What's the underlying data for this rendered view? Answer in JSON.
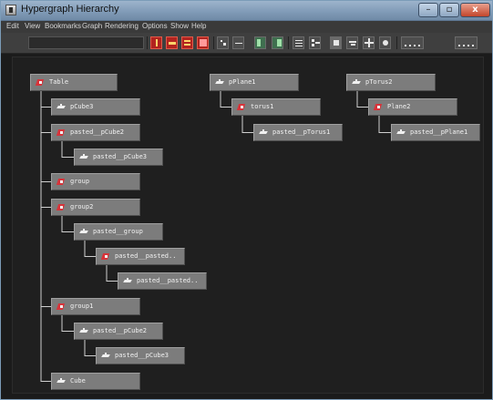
{
  "window": {
    "title": "Hypergraph Hierarchy",
    "buttons": {
      "minimize": "–",
      "maximize": "▫",
      "close": "x"
    }
  },
  "menu": [
    "Edit",
    "View",
    "Bookmarks",
    "Graph",
    "Rendering",
    "Options",
    "Show",
    "Help"
  ],
  "toolbar": {
    "name_field_value": "",
    "icons": [
      "filter-red-icon",
      "key-red-icon",
      "layers-red-icon",
      "expand-red-icon",
      "zoom-in-icon",
      "zoom-out-icon",
      "frame-all-icon",
      "frame-selected-icon",
      "align-icon",
      "hierarchy-icon",
      "render-icon",
      "toggle-icon",
      "layout-icon",
      "options-icon",
      "grid-icon",
      "dots-icon"
    ]
  },
  "graph": {
    "nodes": [
      {
        "name": "table",
        "label": "Table",
        "icon": "transform"
      },
      {
        "name": "pcube3",
        "label": "pCube3",
        "icon": "mesh"
      },
      {
        "name": "pasted-pcube2",
        "label": "pasted__pCube2",
        "icon": "transform"
      },
      {
        "name": "pasted-pcube3",
        "label": "pasted__pCube3",
        "icon": "mesh"
      },
      {
        "name": "group",
        "label": "group",
        "icon": "transform"
      },
      {
        "name": "group2",
        "label": "group2",
        "icon": "transform"
      },
      {
        "name": "pasted-group",
        "label": "pasted__group",
        "icon": "mesh"
      },
      {
        "name": "pasted-pasted-1",
        "label": "pasted__pasted..",
        "icon": "transform"
      },
      {
        "name": "pasted-pasted-2",
        "label": "pasted__pasted..",
        "icon": "mesh"
      },
      {
        "name": "group1",
        "label": "group1",
        "icon": "transform"
      },
      {
        "name": "pasted-pcube2-b",
        "label": "pasted__pCube2",
        "icon": "mesh"
      },
      {
        "name": "pasted-pcube3-b",
        "label": "pasted__pCube3",
        "icon": "mesh"
      },
      {
        "name": "cube",
        "label": "Cube",
        "icon": "mesh"
      },
      {
        "name": "pplane1",
        "label": "pPlane1",
        "icon": "mesh"
      },
      {
        "name": "torus1",
        "label": "torus1",
        "icon": "transform"
      },
      {
        "name": "pasted-ptorus1",
        "label": "pasted__pTorus1",
        "icon": "mesh"
      },
      {
        "name": "ptorus2",
        "label": "pTorus2",
        "icon": "mesh"
      },
      {
        "name": "plane2",
        "label": "Plane2",
        "icon": "transform"
      },
      {
        "name": "pasted-pplane1",
        "label": "pasted__pPlane1",
        "icon": "mesh"
      }
    ],
    "edges": [
      [
        "table",
        "pcube3"
      ],
      [
        "table",
        "pasted-pcube2"
      ],
      [
        "pasted-pcube2",
        "pasted-pcube3"
      ],
      [
        "table",
        "group"
      ],
      [
        "table",
        "group2"
      ],
      [
        "group2",
        "pasted-group"
      ],
      [
        "pasted-group",
        "pasted-pasted-1"
      ],
      [
        "pasted-pasted-1",
        "pasted-pasted-2"
      ],
      [
        "table",
        "group1"
      ],
      [
        "group1",
        "pasted-pcube2-b"
      ],
      [
        "pasted-pcube2-b",
        "pasted-pcube3-b"
      ],
      [
        "table",
        "cube"
      ],
      [
        "pplane1",
        "torus1"
      ],
      [
        "torus1",
        "pasted-ptorus1"
      ],
      [
        "ptorus2",
        "plane2"
      ],
      [
        "plane2",
        "pasted-pplane1"
      ]
    ]
  },
  "colors": {
    "node_fill": "#7c7c7c",
    "wire": "#cfcfcf",
    "graph_bg": "#1f1f1f",
    "transform_icon": "#d8333a"
  }
}
